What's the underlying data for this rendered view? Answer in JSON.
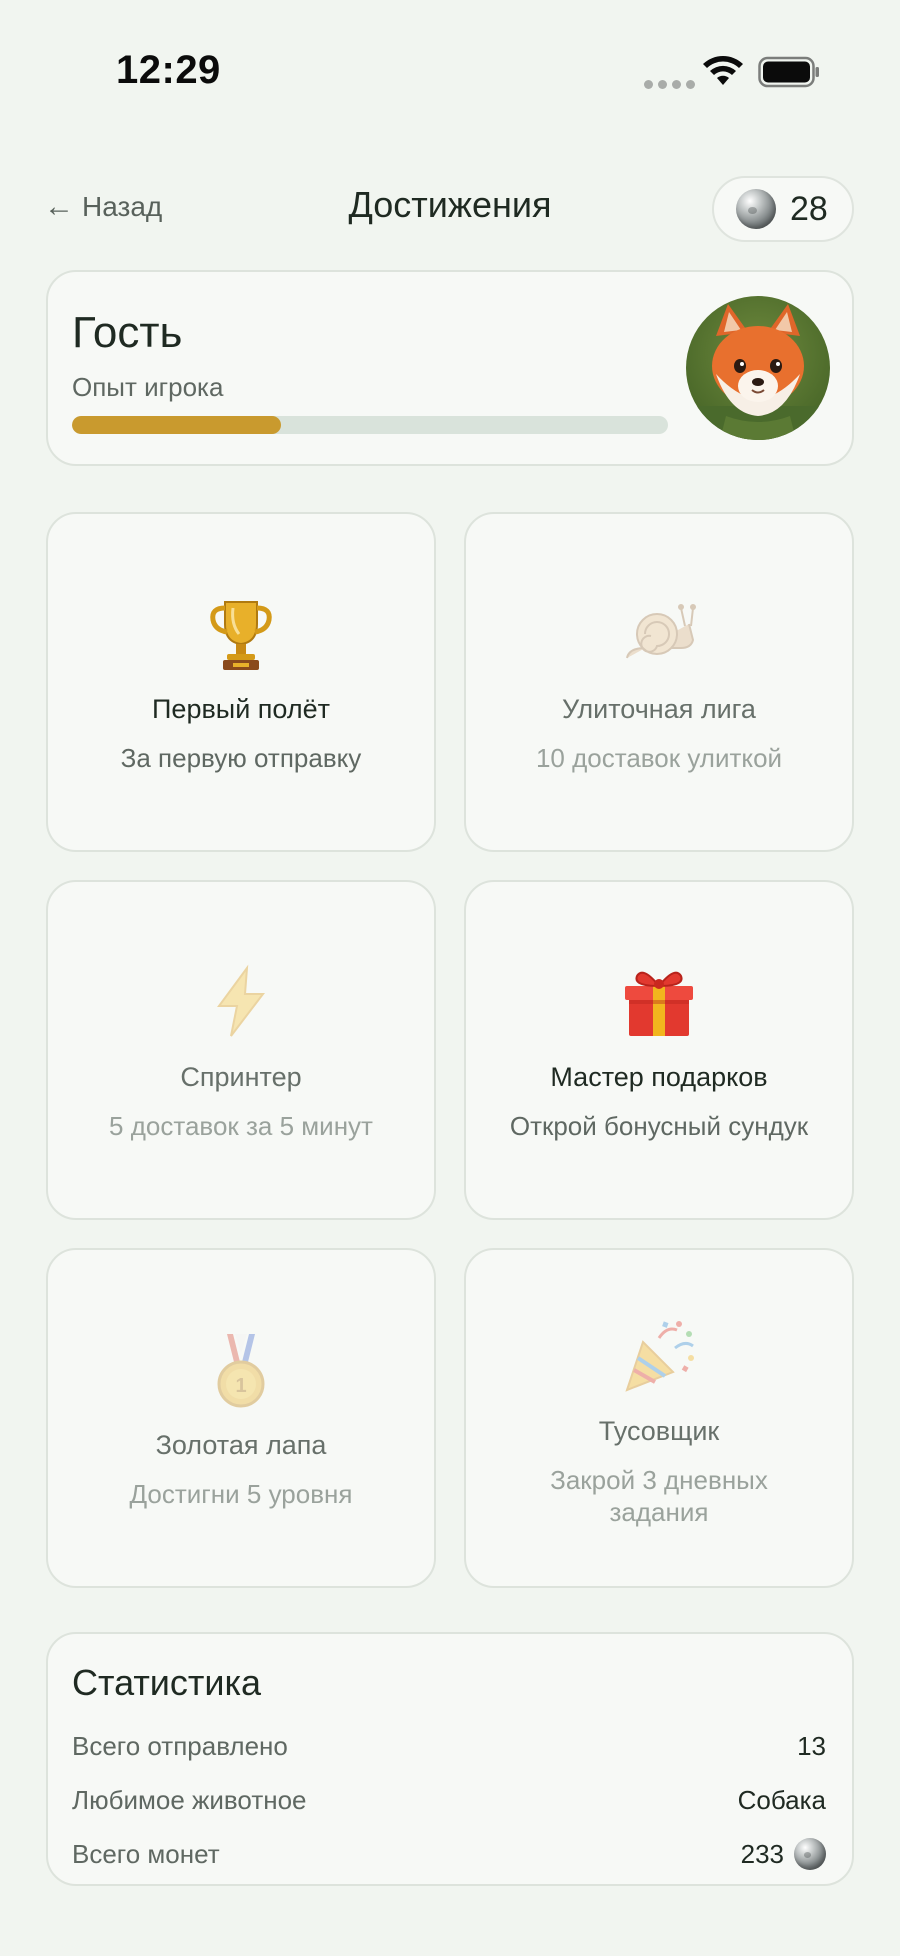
{
  "status_bar": {
    "time": "12:29"
  },
  "header": {
    "back_label": "Назад",
    "back_arrow": "←",
    "title": "Достижения",
    "coins": "28"
  },
  "profile": {
    "name": "Гость",
    "xp_label": "Опыт игрока",
    "xp_progress": 0.35
  },
  "achievements": [
    {
      "icon": "trophy-icon",
      "title": "Первый полёт",
      "description": "За первую отправку",
      "unlocked": true
    },
    {
      "icon": "snail-icon",
      "title": "Улиточная лига",
      "description": "10 доставок улиткой",
      "unlocked": false
    },
    {
      "icon": "lightning-icon",
      "title": "Спринтер",
      "description": "5 доставок за 5 минут",
      "unlocked": false
    },
    {
      "icon": "gift-icon",
      "title": "Мастер подарков",
      "description": "Открой бонусный сундук",
      "unlocked": true
    },
    {
      "icon": "medal-icon",
      "title": "Золотая лапа",
      "description": "Достигни 5 уровня",
      "unlocked": false
    },
    {
      "icon": "party-popper-icon",
      "title": "Тусовщик",
      "description": "Закрой 3 дневных задания",
      "unlocked": false
    }
  ],
  "stats": {
    "title": "Статистика",
    "rows": [
      {
        "label": "Всего отправлено",
        "value": "13"
      },
      {
        "label": "Любимое животное",
        "value": "Собака"
      },
      {
        "label": "Всего монет",
        "value": "233"
      }
    ]
  },
  "colors": {
    "background": "#f1f5f0",
    "card": "#f7f9f6",
    "progress_fill": "#c99a2e",
    "progress_track": "#d9e3db"
  }
}
